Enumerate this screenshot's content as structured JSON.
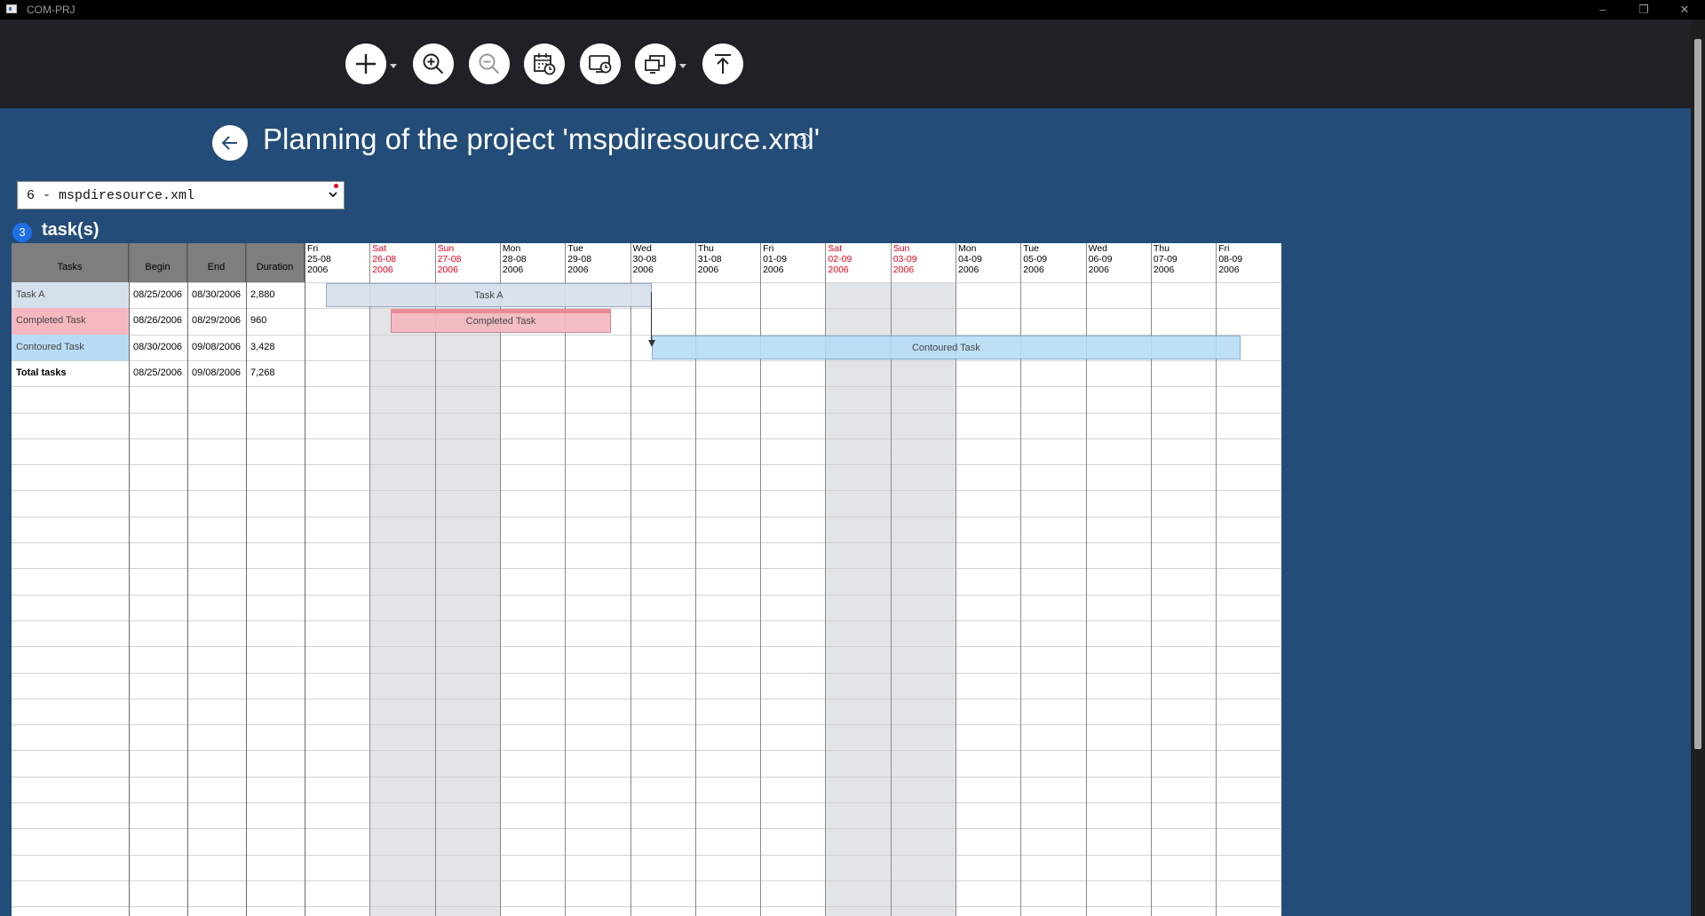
{
  "window": {
    "title": "COM-PRJ",
    "minimize": "–",
    "restore": "❐",
    "close": "✕"
  },
  "toolbar": {
    "buttons": [
      "add-icon",
      "zoom-in-icon",
      "zoom-out-icon",
      "calendar-clock-icon",
      "display-clock-icon",
      "screens-icon",
      "upload-top-icon"
    ]
  },
  "header": {
    "title": "Planning of the project 'mspdiresource.xml'",
    "help": "?"
  },
  "project_select": {
    "value": "6 - mspdiresource.xml"
  },
  "tasks_count": {
    "count": "3",
    "label": "task(s)"
  },
  "table": {
    "headers": {
      "tasks": "Tasks",
      "begin": "Begin",
      "end": "End",
      "duration": "Duration"
    },
    "rows": [
      {
        "name": "Task A",
        "begin": "08/25/2006",
        "end": "08/30/2006",
        "duration": "2,880",
        "color": "#d6e0ec"
      },
      {
        "name": "Completed Task",
        "begin": "08/26/2006",
        "end": "08/29/2006",
        "duration": "960",
        "color": "#f5b8c0"
      },
      {
        "name": "Contoured Task",
        "begin": "08/30/2006",
        "end": "09/08/2006",
        "duration": "3,428",
        "color": "#b9dcf5"
      },
      {
        "name": "Total tasks",
        "begin": "08/25/2006",
        "end": "09/08/2006",
        "duration": "7,268"
      }
    ]
  },
  "timeline": {
    "days": [
      {
        "dow": "Fri",
        "date": "25-08",
        "year": "2006",
        "weekend": false
      },
      {
        "dow": "Sat",
        "date": "26-08",
        "year": "2006",
        "weekend": true
      },
      {
        "dow": "Sun",
        "date": "27-08",
        "year": "2006",
        "weekend": true
      },
      {
        "dow": "Mon",
        "date": "28-08",
        "year": "2006",
        "weekend": false
      },
      {
        "dow": "Tue",
        "date": "29-08",
        "year": "2006",
        "weekend": false
      },
      {
        "dow": "Wed",
        "date": "30-08",
        "year": "2006",
        "weekend": false
      },
      {
        "dow": "Thu",
        "date": "31-08",
        "year": "2006",
        "weekend": false
      },
      {
        "dow": "Fri",
        "date": "01-09",
        "year": "2006",
        "weekend": false
      },
      {
        "dow": "Sat",
        "date": "02-09",
        "year": "2006",
        "weekend": true
      },
      {
        "dow": "Sun",
        "date": "03-09",
        "year": "2006",
        "weekend": true
      },
      {
        "dow": "Mon",
        "date": "04-09",
        "year": "2006",
        "weekend": false
      },
      {
        "dow": "Tue",
        "date": "05-09",
        "year": "2006",
        "weekend": false
      },
      {
        "dow": "Wed",
        "date": "06-09",
        "year": "2006",
        "weekend": false
      },
      {
        "dow": "Thu",
        "date": "07-09",
        "year": "2006",
        "weekend": false
      },
      {
        "dow": "Fri",
        "date": "08-09",
        "year": "2006",
        "weekend": false
      }
    ]
  },
  "bars": [
    {
      "label": "Task A",
      "start_day": 0.33,
      "end_day": 5.33,
      "row": 0,
      "fill": "#d6e0ec",
      "border": "#8fa3bd"
    },
    {
      "label": "Completed Task",
      "start_day": 1.33,
      "end_day": 4.7,
      "row": 1,
      "fill": "#f5b8c0",
      "border": "#c57b86",
      "progress_top": "#e98c98"
    },
    {
      "label": "Contoured Task",
      "start_day": 5.33,
      "end_day": 14.38,
      "row": 2,
      "fill": "#b9dcf5",
      "border": "#7aa6c8"
    }
  ],
  "colors": {
    "background": "#234d78",
    "toolbar": "#1f2126",
    "weekend_header": "#e0001b"
  }
}
